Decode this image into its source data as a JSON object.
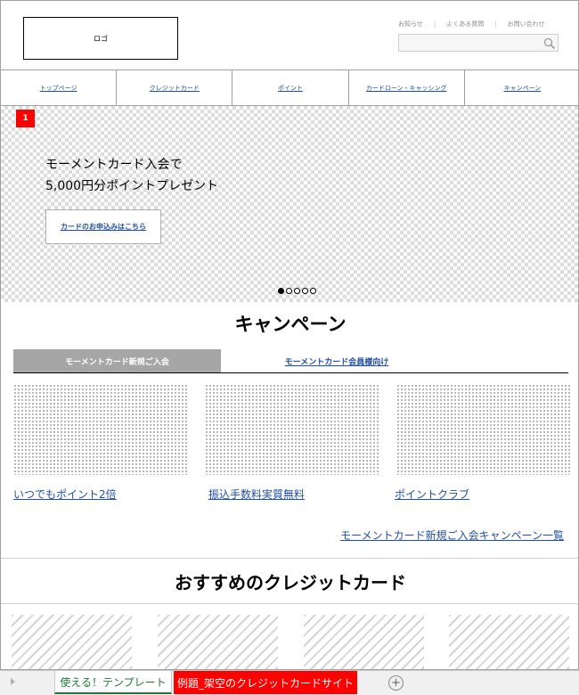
{
  "header": {
    "logo_text": "ロゴ",
    "util_links": [
      "お知らせ",
      "よくある質問",
      "お問い合わせ"
    ],
    "search_placeholder": ""
  },
  "nav": {
    "items": [
      "トップページ",
      "クレジットカード",
      "ポイント",
      "カードローン・キャッシング",
      "キャンペーン"
    ]
  },
  "hero": {
    "slide_number": "1",
    "line1": "モーメントカード入会で",
    "line2": "5,000円分ポイントプレゼント",
    "button": "カードのお申込みはこちら",
    "slide_count": 5,
    "active_slide": 1
  },
  "campaign": {
    "title": "キャンペーン",
    "tabs": [
      "モーメントカード新規ご入会",
      "モーメントカード会員様向け"
    ],
    "cards": [
      "いつでもポイント2倍",
      "振込手数料実質無料",
      "ポイントクラブ"
    ],
    "all_link": "モーメントカード新規ご入会キャンペーン一覧"
  },
  "recommended": {
    "title": "おすすめのクレジットカード"
  },
  "sheets": {
    "tabs": [
      "使える！テンプレート",
      "例題_架空のクレジットカードサイト"
    ],
    "active_color": "#1e7a3a",
    "highlight_color": "#ff0000"
  }
}
